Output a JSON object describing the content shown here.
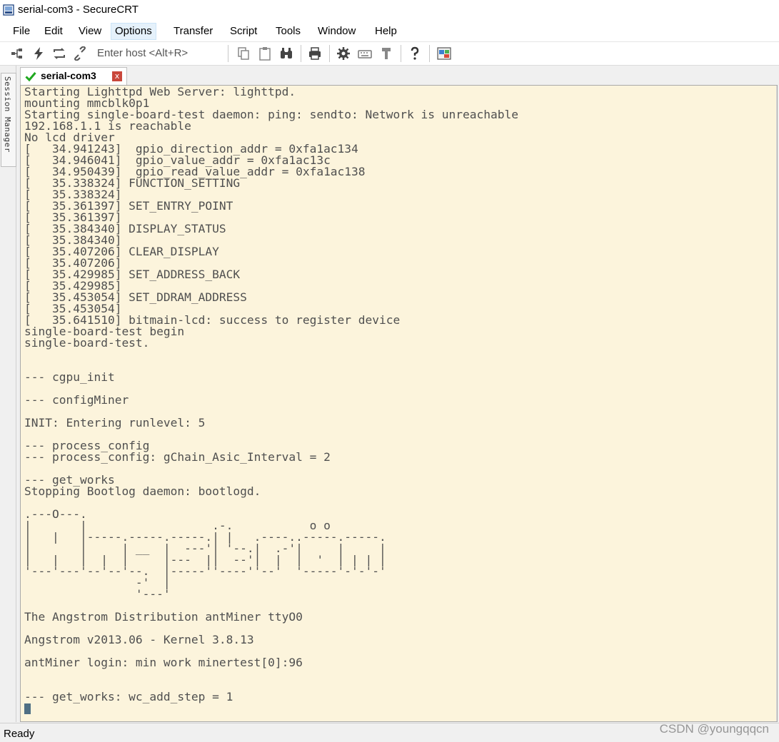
{
  "window": {
    "title": "serial-com3 - SecureCRT"
  },
  "menu": [
    "File",
    "Edit",
    "View",
    "Options",
    "Transfer",
    "Script",
    "Tools",
    "Window",
    "Help"
  ],
  "toolbar": {
    "host_placeholder": "Enter host <Alt+R>"
  },
  "sidebar": {
    "label": "Session Manager"
  },
  "tab": {
    "label": "serial-com3",
    "close": "x"
  },
  "terminal": {
    "lines": [
      "Starting Lighttpd Web Server: lighttpd.",
      "mounting mmcblk0p1",
      "Starting single-board-test daemon: ping: sendto: Network is unreachable",
      "192.168.1.1 is reachable",
      "No lcd driver",
      "[   34.941243]  gpio_direction_addr = 0xfa1ac134",
      "[   34.946041]  gpio_value_addr = 0xfa1ac13c",
      "[   34.950439]  gpio_read_value_addr = 0xfa1ac138",
      "[   35.338324] FUNCTION_SETTING",
      "[   35.338324]",
      "[   35.361397] SET_ENTRY_POINT",
      "[   35.361397]",
      "[   35.384340] DISPLAY_STATUS",
      "[   35.384340]",
      "[   35.407206] CLEAR_DISPLAY",
      "[   35.407206]",
      "[   35.429985] SET_ADDRESS_BACK",
      "[   35.429985]",
      "[   35.453054] SET_DDRAM_ADDRESS",
      "[   35.453054]",
      "[   35.641510] bitmain-lcd: success to register device",
      "single-board-test begin",
      "single-board-test.",
      "",
      "",
      "--- cgpu_init",
      "",
      "--- configMiner",
      "",
      "INIT: Entering runlevel: 5",
      "",
      "--- process_config",
      "--- process_config: gChain_Asic_Interval = 2",
      "",
      "--- get_works",
      "Stopping Bootlog daemon: bootlogd.",
      "",
      ".---O---.",
      "|       |                  .-.           o o",
      "|   |   |-----.-----.-----.| |   .----..-----.-----.",
      "|       |     | __  |  ---'| '--.|  .-'|     |     |",
      "|   |   |  |  |     |---  ||  --'|  |  |  '  | | | |",
      "'---'---'--'--'--.  |-----''----''--'  '-----'-'-'-'",
      "                -'  |",
      "                '---'",
      "",
      "The Angstrom Distribution antMiner ttyO0",
      "",
      "Angstrom v2013.06 - Kernel 3.8.13",
      "",
      "antMiner login: min work minertest[0]:96",
      "",
      "",
      "--- get_works: wc_add_step = 1"
    ]
  },
  "status": {
    "text": "Ready",
    "watermark": "CSDN @youngqqcn"
  },
  "icons": [
    "connect-icon",
    "quick-connect-icon",
    "reconnect-icon",
    "disconnect-icon",
    "copy-icon",
    "paste-icon",
    "find-icon",
    "print-icon",
    "session-options-icon",
    "keymap-icon",
    "sftp-icon",
    "help-icon",
    "screen-capture-icon"
  ]
}
